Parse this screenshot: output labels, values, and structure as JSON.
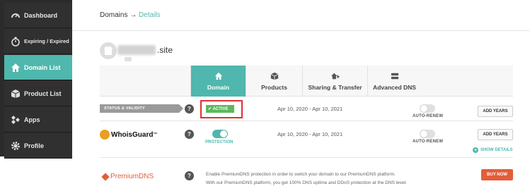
{
  "sidebar": {
    "items": [
      {
        "label": "Dashboard",
        "icon": "gauge-icon"
      },
      {
        "label": "Expiring / Expired",
        "icon": "stopwatch-icon"
      },
      {
        "label": "Domain List",
        "icon": "home-icon",
        "active": true
      },
      {
        "label": "Product List",
        "icon": "box-icon"
      },
      {
        "label": "Apps",
        "icon": "apps-icon"
      },
      {
        "label": "Profile",
        "icon": "gear-icon"
      }
    ]
  },
  "breadcrumb": {
    "root": "Domains",
    "sep": "→",
    "current": "Details"
  },
  "domain": {
    "tld": ".site"
  },
  "tabs": [
    {
      "label": "Domain",
      "icon": "home-icon",
      "active": true
    },
    {
      "label": "Products",
      "icon": "box-icon"
    },
    {
      "label": "Sharing & Transfer",
      "icon": "share-icon"
    },
    {
      "label": "Advanced DNS",
      "icon": "server-icon"
    }
  ],
  "status_row": {
    "tag": "STATUS & VALIDITY",
    "help": "?",
    "badge": "✔ ACTIVE",
    "dates": "Apr 10, 2020 - Apr 10, 2021",
    "toggle_label": "AUTO-RENEW",
    "button": "ADD YEARS"
  },
  "whois_row": {
    "brand": "WhoisGuard",
    "tm": "™",
    "help": "?",
    "protection_label": "PROTECTION",
    "dates": "Apr 10, 2020 - Apr 10, 2021",
    "toggle_label": "AUTO-RENEW",
    "button": "ADD YEARS",
    "show_details": "SHOW DETAILS"
  },
  "pdns_row": {
    "brand": "PremiumDNS",
    "help": "?",
    "line1": "Enable PremiumDNS protection in order to switch your domain to our PremiumDNS platform.",
    "line2": "With our PremiumDNS platform, you get 100% DNS uptime and DDoS protection at the DNS level.",
    "button": "BUY NOW"
  },
  "colors": {
    "accent": "#4fb7ad",
    "sidebar": "#2b2b2b",
    "active_badge": "#5cb85c",
    "buy": "#e35d3a",
    "highlight": "#e03030"
  }
}
